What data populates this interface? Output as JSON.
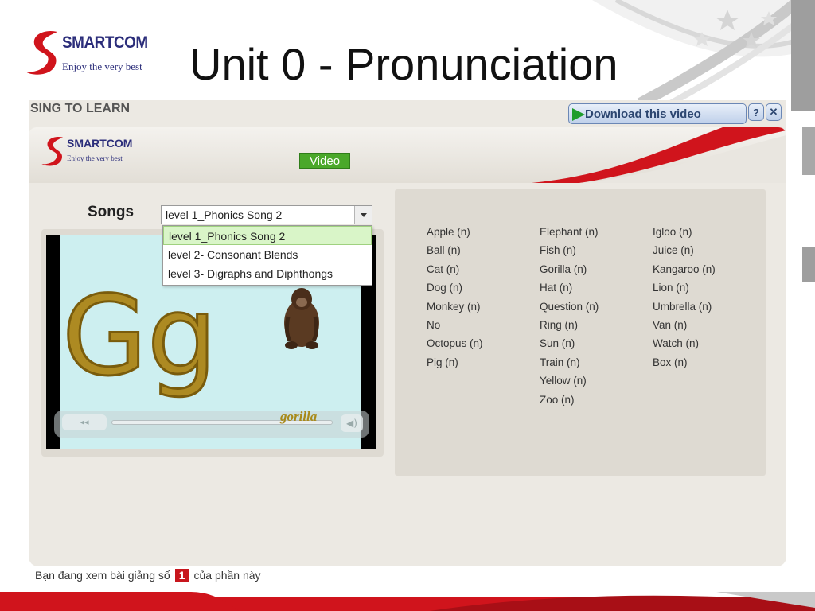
{
  "slide": {
    "brand_name": "SMARTCOM",
    "brand_tagline": "Enjoy the very best",
    "title": "Unit 0 - Pronunciation"
  },
  "player": {
    "section_title": "SING TO LEARN",
    "download_label": "Download this video",
    "help_label": "?",
    "close_label": "✕",
    "banner_brand": "SMARTCOM",
    "banner_tagline": "Enjoy the very best",
    "video_tab": "Video",
    "songs_label": "Songs",
    "songs_selected": "level 1_Phonics Song 2",
    "songs_options": [
      "level 1_Phonics Song 2",
      "level 2- Consonant Blends",
      "level 3- Digraphs and Diphthongs"
    ],
    "video_letter": "Gg",
    "video_caption": "gorilla",
    "ctrl_play": "◂◂",
    "ctrl_volume": "◀)"
  },
  "words": {
    "col1": [
      "Apple (n)",
      "Ball (n)",
      "Cat (n)",
      "Dog (n)",
      "Monkey (n)",
      "No",
      "Octopus (n)",
      "Pig (n)"
    ],
    "col2": [
      "Elephant (n)",
      "Fish (n)",
      "Gorilla (n)",
      "Hat (n)",
      "Question (n)",
      "Ring (n)",
      "Sun (n)",
      "Train (n)",
      "Yellow (n)",
      "Zoo (n)"
    ],
    "col3": [
      "Igloo (n)",
      "Juice (n)",
      "Kangaroo (n)",
      "Lion (n)",
      "Umbrella (n)",
      "Van (n)",
      "Watch (n)",
      "Box (n)"
    ]
  },
  "footer": {
    "text_before": "Bạn đang xem bài giảng số",
    "number": "1",
    "text_after": "của phần này"
  },
  "colors": {
    "brand_navy": "#2b2d7a",
    "brand_red": "#d0141c",
    "video_tab_green": "#4aa82a"
  }
}
